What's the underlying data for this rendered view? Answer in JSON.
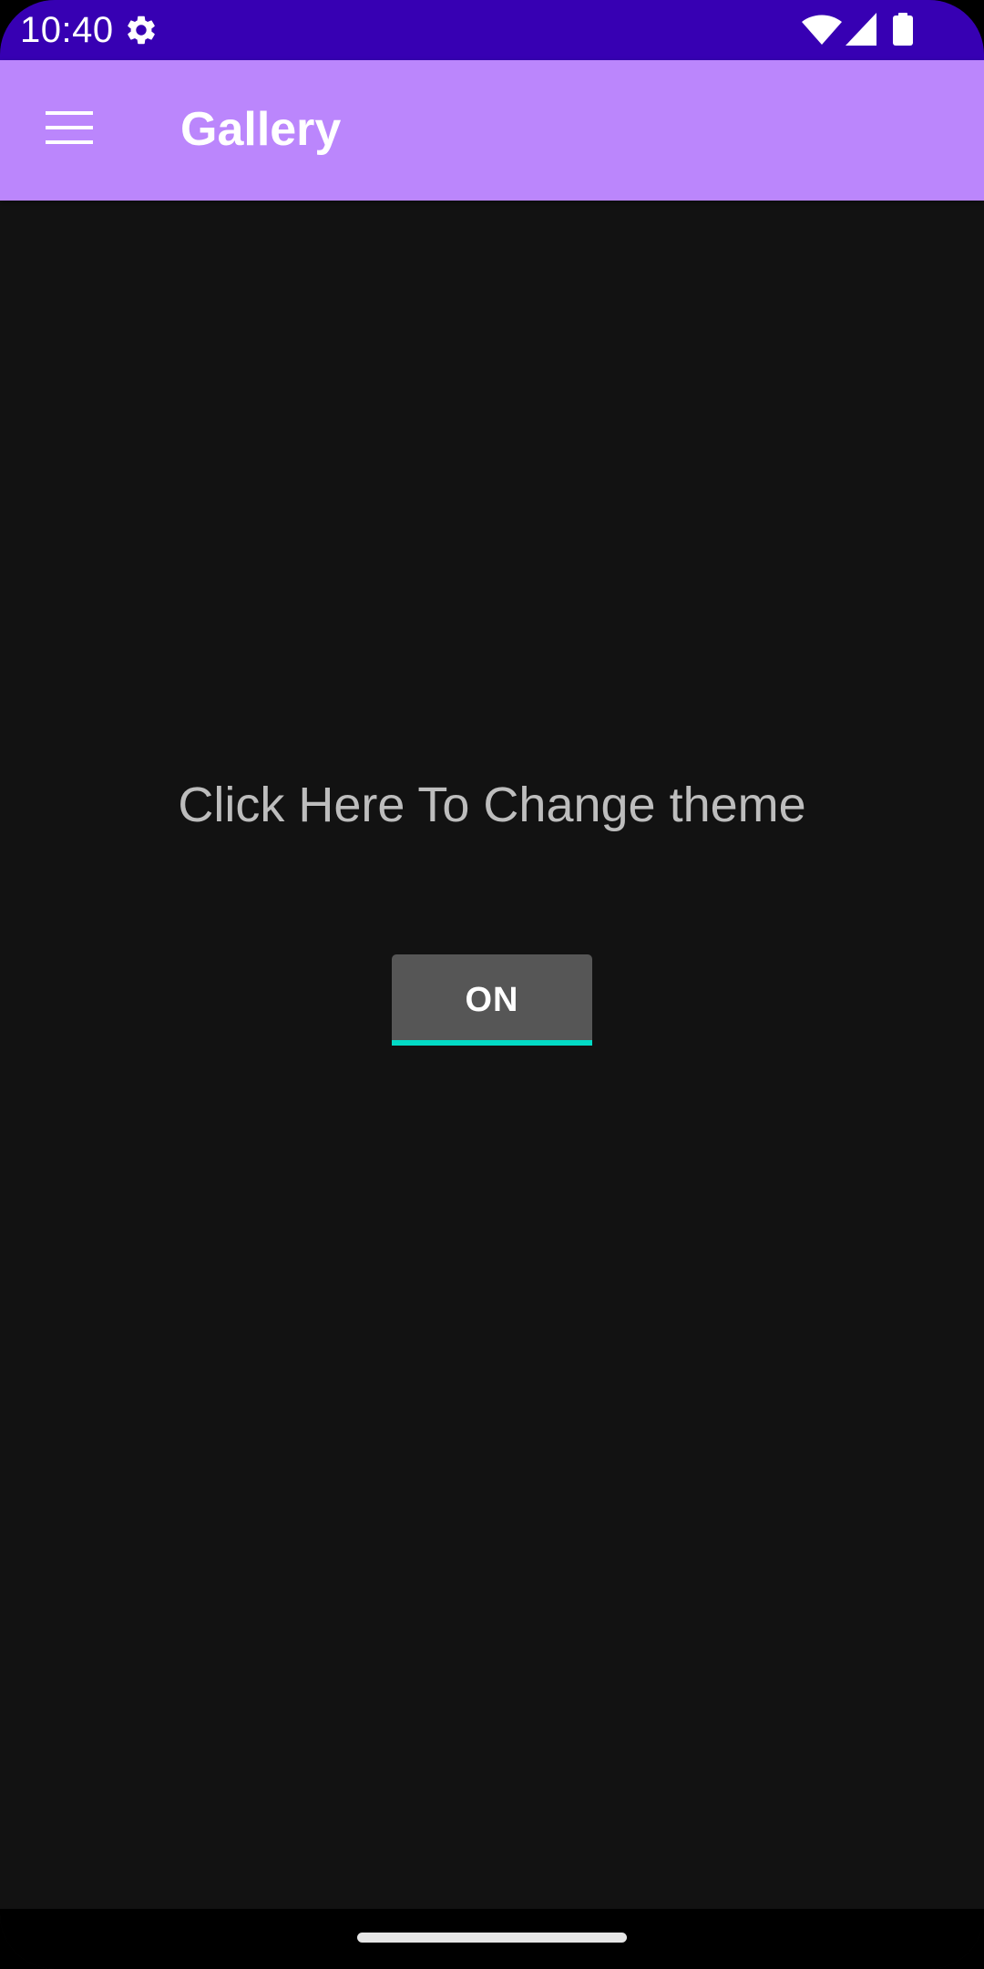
{
  "status_bar": {
    "time": "10:40",
    "background": "#3700b3",
    "icons": [
      "settings-gear-icon",
      "wifi-icon",
      "cell-signal-icon",
      "battery-icon"
    ]
  },
  "app_bar": {
    "title": "Gallery",
    "background": "#bb86fc",
    "menu_icon": "hamburger-menu-icon"
  },
  "main": {
    "background": "#121212",
    "prompt": "Click Here To Change theme",
    "toggle_button": {
      "label": "ON",
      "background": "#565656",
      "accent": "#03dac5"
    }
  },
  "nav_bar": {
    "gesture": "home-handle"
  }
}
